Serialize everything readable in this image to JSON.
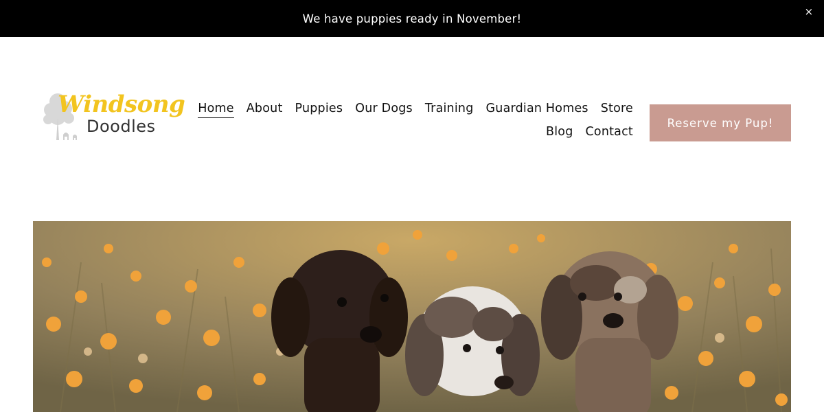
{
  "announcement": {
    "text": "We have puppies ready in November!",
    "close_icon": "close-icon",
    "close_glyph": "×",
    "background": "#000000"
  },
  "logo": {
    "line1": "Windsong",
    "line2": "Doodles",
    "accent_color": "#f2c41f",
    "icon": "tree-with-dogs-icon"
  },
  "nav": {
    "items": [
      {
        "label": "Home",
        "active": true
      },
      {
        "label": "About",
        "active": false
      },
      {
        "label": "Puppies",
        "active": false
      },
      {
        "label": "Our Dogs",
        "active": false
      },
      {
        "label": "Training",
        "active": false
      },
      {
        "label": "Guardian Homes",
        "active": false
      },
      {
        "label": "Store",
        "active": false
      },
      {
        "label": "Blog",
        "active": false
      },
      {
        "label": "Contact",
        "active": false
      }
    ]
  },
  "cta": {
    "label": "Reserve my Pup!",
    "color": "#c99b91"
  },
  "hero": {
    "subject": "three puppies in a field of orange flowers"
  }
}
